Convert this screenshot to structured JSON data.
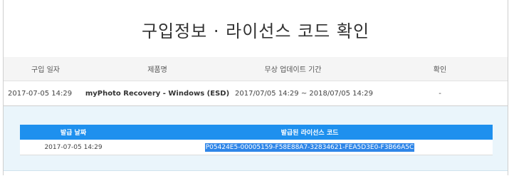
{
  "page": {
    "title": "구입정보 · 라이선스 코드 확인"
  },
  "purchase_table": {
    "headers": [
      "구입 일자",
      "제품명",
      "무상 업데이트 기간",
      "확인"
    ],
    "row": {
      "date": "2017-07-05 14:29",
      "product": "myPhoto Recovery - Windows (ESD)",
      "update_period": "2017/07/05 14:29 ~ 2018/07/05 14:29",
      "confirm": "-"
    }
  },
  "license_table": {
    "headers": [
      "발급 날짜",
      "발급된 라이선스 코드"
    ],
    "row": {
      "issue_date": "2017-07-05 14:29",
      "license_code": "P05424E5-00005159-F58E88A7-32834621-FEA5D3E0-F3B66A5C"
    }
  },
  "colors": {
    "license_header_bg": "#1e90ee",
    "panel_bg": "#eaf5fb",
    "selection_bg": "#2f86e8"
  }
}
